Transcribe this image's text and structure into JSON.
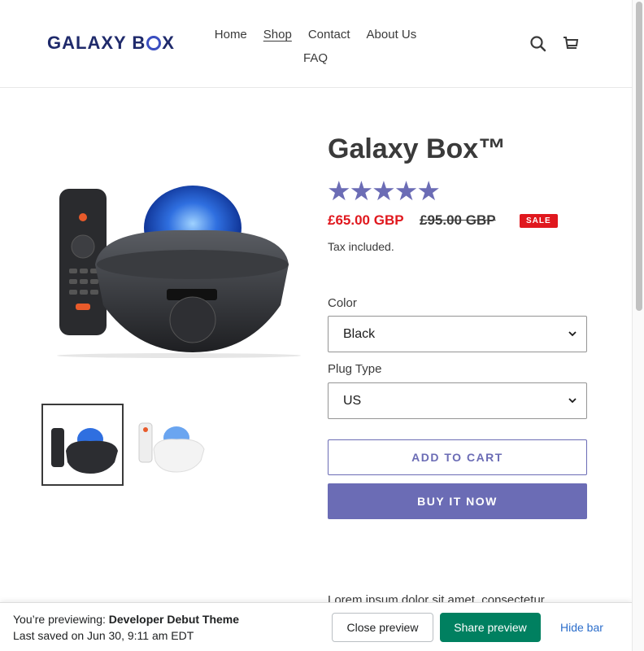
{
  "header": {
    "logo_text_a": "GALAXY B",
    "logo_text_b": "X",
    "nav": [
      "Home",
      "Shop",
      "Contact",
      "About Us",
      "FAQ"
    ],
    "search_icon": "search-icon",
    "cart_icon": "cart-icon"
  },
  "product": {
    "title": "Galaxy Box™",
    "rating": 5,
    "rating_max": 5,
    "stars": "★★★★★",
    "price": "£65.00 GBP",
    "compare_price": "£95.00 GBP",
    "sale_badge": "SALE",
    "tax_note": "Tax included.",
    "color_label": "Color",
    "color_value": "Black",
    "plug_label": "Plug Type",
    "plug_value": "US",
    "add_to_cart": "ADD TO CART",
    "buy_now": "BUY IT NOW",
    "description": "Lorem ipsum dolor sit amet, consectetur adipiscing elit. Donec dignissim odio non molestie"
  },
  "preview_bar": {
    "prefix": "You’re previewing: ",
    "theme": "Developer Debut Theme",
    "saved": "Last saved on Jun 30, 9:11 am EDT",
    "close_label": "Close preview",
    "share_label": "Share preview",
    "hide_label": "Hide bar"
  },
  "colors": {
    "accent": "#6b6cb5",
    "sale": "#e0181e",
    "share_green": "#008060",
    "link_blue": "#2c6ecb"
  }
}
